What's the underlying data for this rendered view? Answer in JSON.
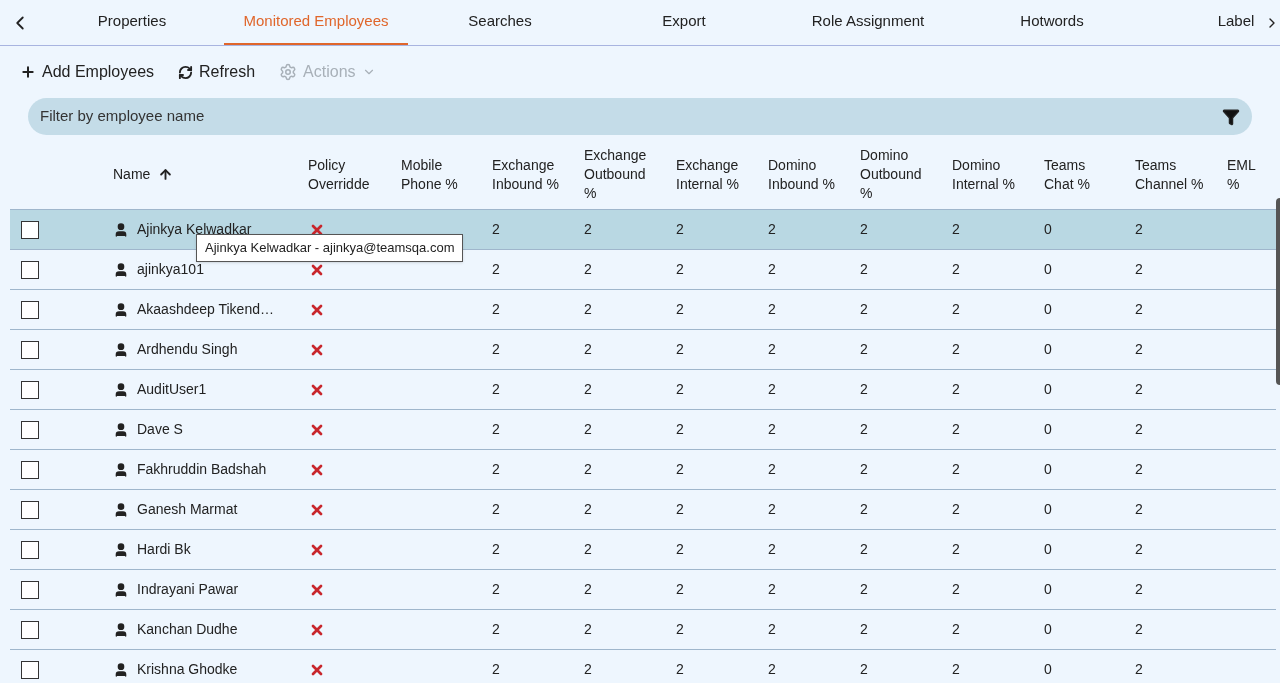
{
  "tabs": [
    {
      "label": "Properties",
      "selected": false
    },
    {
      "label": "Monitored Employees",
      "selected": true
    },
    {
      "label": "Searches",
      "selected": false
    },
    {
      "label": "Export",
      "selected": false
    },
    {
      "label": "Role Assignment",
      "selected": false
    },
    {
      "label": "Hotwords",
      "selected": false
    },
    {
      "label": "Label",
      "selected": false
    }
  ],
  "toolbar": [
    {
      "kind": "add",
      "label": "Add Employees",
      "disabled": false
    },
    {
      "kind": "refresh",
      "label": "Refresh",
      "disabled": false
    },
    {
      "kind": "actions",
      "label": "Actions",
      "disabled": true
    }
  ],
  "filter": {
    "placeholder": "Filter by employee name"
  },
  "table": {
    "columns": [
      "Name",
      "Policy Overridde",
      "Mobile Phone %",
      "Exchange Inbound %",
      "Exchange Outbound %",
      "Exchange Internal %",
      "Domino Inbound %",
      "Domino Outbound %",
      "Domino Internal %",
      "Teams Chat %",
      "Teams Channel %",
      "EML %"
    ],
    "rows": [
      {
        "selected": true,
        "checked": false,
        "policy_overridden": false,
        "cells": [
          "Ajinkya Kelwadkar",
          "",
          "",
          "2",
          "2",
          "2",
          "2",
          "2",
          "2",
          "0",
          "2",
          ""
        ]
      },
      {
        "selected": false,
        "checked": false,
        "policy_overridden": false,
        "cells": [
          "ajinkya101",
          "",
          "",
          "2",
          "2",
          "2",
          "2",
          "2",
          "2",
          "0",
          "2",
          ""
        ]
      },
      {
        "selected": false,
        "checked": false,
        "policy_overridden": false,
        "cells": [
          "Akaashdeep Tikend…",
          "",
          "",
          "2",
          "2",
          "2",
          "2",
          "2",
          "2",
          "0",
          "2",
          ""
        ]
      },
      {
        "selected": false,
        "checked": false,
        "policy_overridden": false,
        "cells": [
          "Ardhendu Singh",
          "",
          "",
          "2",
          "2",
          "2",
          "2",
          "2",
          "2",
          "0",
          "2",
          ""
        ]
      },
      {
        "selected": false,
        "checked": false,
        "policy_overridden": false,
        "cells": [
          "AuditUser1",
          "",
          "",
          "2",
          "2",
          "2",
          "2",
          "2",
          "2",
          "0",
          "2",
          ""
        ]
      },
      {
        "selected": false,
        "checked": false,
        "policy_overridden": false,
        "cells": [
          "Dave S",
          "",
          "",
          "2",
          "2",
          "2",
          "2",
          "2",
          "2",
          "0",
          "2",
          ""
        ]
      },
      {
        "selected": false,
        "checked": false,
        "policy_overridden": false,
        "cells": [
          "Fakhruddin Badshah",
          "",
          "",
          "2",
          "2",
          "2",
          "2",
          "2",
          "2",
          "0",
          "2",
          ""
        ]
      },
      {
        "selected": false,
        "checked": false,
        "policy_overridden": false,
        "cells": [
          "Ganesh Marmat",
          "",
          "",
          "2",
          "2",
          "2",
          "2",
          "2",
          "2",
          "0",
          "2",
          ""
        ]
      },
      {
        "selected": false,
        "checked": false,
        "policy_overridden": false,
        "cells": [
          "Hardi Bk",
          "",
          "",
          "2",
          "2",
          "2",
          "2",
          "2",
          "2",
          "0",
          "2",
          ""
        ]
      },
      {
        "selected": false,
        "checked": false,
        "policy_overridden": false,
        "cells": [
          "Indrayani Pawar",
          "",
          "",
          "2",
          "2",
          "2",
          "2",
          "2",
          "2",
          "0",
          "2",
          ""
        ]
      },
      {
        "selected": false,
        "checked": false,
        "policy_overridden": false,
        "cells": [
          "Kanchan Dudhe",
          "",
          "",
          "2",
          "2",
          "2",
          "2",
          "2",
          "2",
          "0",
          "2",
          ""
        ]
      },
      {
        "selected": false,
        "checked": false,
        "policy_overridden": false,
        "cells": [
          "Krishna Ghodke",
          "",
          "",
          "2",
          "2",
          "2",
          "2",
          "2",
          "2",
          "0",
          "2",
          ""
        ]
      }
    ]
  },
  "tooltip": {
    "text": "Ajinkya Kelwadkar - ajinkya@teamsqa.com"
  }
}
